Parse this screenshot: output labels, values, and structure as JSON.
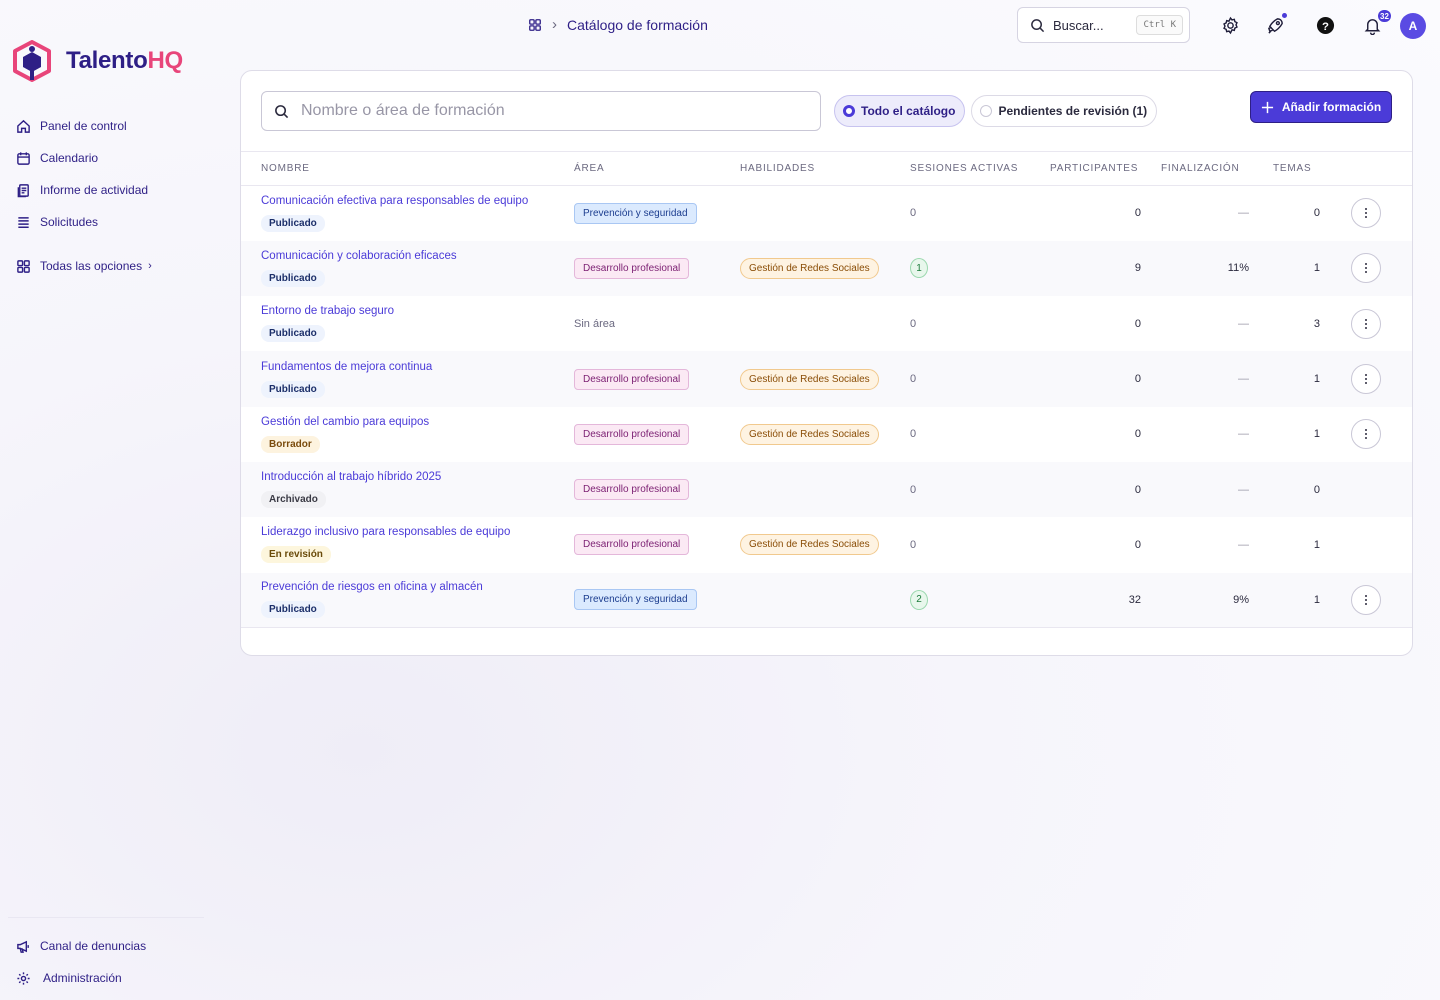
{
  "brand": {
    "name_part1": "Talento",
    "name_part2": "HQ"
  },
  "sidebar": {
    "items": [
      {
        "label": "Panel de control"
      },
      {
        "label": "Calendario"
      },
      {
        "label": "Informe de actividad"
      },
      {
        "label": "Solicitudes"
      },
      {
        "label": "Todas las opciones"
      }
    ],
    "bottom": [
      {
        "label": "Canal de denuncias"
      },
      {
        "label": "Administración"
      }
    ]
  },
  "header": {
    "breadcrumb": "Catálogo de formación",
    "search_label": "Buscar...",
    "search_shortcut": "Ctrl K",
    "notifications_count": "32",
    "avatar_initial": "A"
  },
  "toolbar": {
    "filter_placeholder": "Nombre o área de formación",
    "segments": [
      "Todo el catálogo",
      "Pendientes de revisión (1)"
    ],
    "active_segment": "Todo el catálogo",
    "add_button": "Añadir formación"
  },
  "table": {
    "columns": [
      "NOMBRE",
      "ÁREA",
      "HABILIDADES",
      "SESIONES ACTIVAS",
      "PARTICIPANTES",
      "FINALIZACIÓN",
      "TEMAS"
    ],
    "rows": [
      {
        "name": "Comunicación efectiva para responsables de equipo",
        "status": "Publicado",
        "area": "Prevención y seguridad",
        "skill": "",
        "sessions": "0",
        "participants": "0",
        "completion": "—",
        "topics": "0"
      },
      {
        "name": "Comunicación y colaboración eficaces",
        "status": "Publicado",
        "area": "Desarrollo profesional",
        "skill": "Gestión de Redes Sociales",
        "sessions": "1",
        "participants": "9",
        "completion": "11%",
        "topics": "1"
      },
      {
        "name": "Entorno de trabajo seguro",
        "status": "Publicado",
        "area": "Sin área",
        "skill": "",
        "sessions": "0",
        "participants": "0",
        "completion": "—",
        "topics": "3"
      },
      {
        "name": "Fundamentos de mejora continua",
        "status": "Publicado",
        "area": "Desarrollo profesional",
        "skill": "Gestión de Redes Sociales",
        "sessions": "0",
        "participants": "0",
        "completion": "—",
        "topics": "1"
      },
      {
        "name": "Gestión del cambio para equipos",
        "status": "Borrador",
        "area": "Desarrollo profesional",
        "skill": "Gestión de Redes Sociales",
        "sessions": "0",
        "participants": "0",
        "completion": "—",
        "topics": "1"
      },
      {
        "name": "Introducción al trabajo híbrido 2025",
        "status": "Archivado",
        "area": "Desarrollo profesional",
        "skill": "",
        "sessions": "0",
        "participants": "0",
        "completion": "—",
        "topics": "0"
      },
      {
        "name": "Liderazgo inclusivo para responsables de equipo",
        "status": "En revisión",
        "area": "Desarrollo profesional",
        "skill": "Gestión de Redes Sociales",
        "sessions": "0",
        "participants": "0",
        "completion": "—",
        "topics": "1"
      },
      {
        "name": "Prevención de riesgos en oficina y almacén",
        "status": "Publicado",
        "area": "Prevención y seguridad",
        "skill": "",
        "sessions": "2",
        "participants": "32",
        "completion": "9%",
        "topics": "1"
      }
    ]
  },
  "colors": {
    "accent": "#4b3bd8",
    "brand_dark": "#2e1f86",
    "brand_pink": "#e8457a"
  }
}
